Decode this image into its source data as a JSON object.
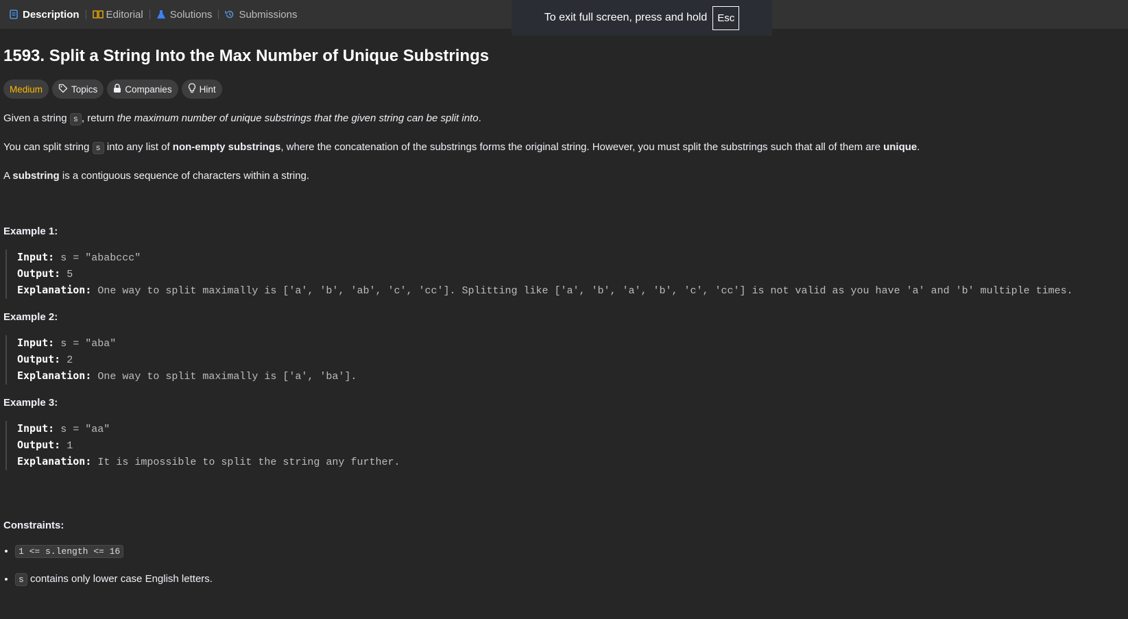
{
  "tabs": {
    "description": "Description",
    "editorial": "Editorial",
    "solutions": "Solutions",
    "submissions": "Submissions"
  },
  "fullscreen": {
    "message": "To exit full screen, press and hold",
    "key": "Esc"
  },
  "problem": {
    "title": "1593. Split a String Into the Max Number of Unique Substrings",
    "tags": {
      "difficulty": "Medium",
      "topics": "Topics",
      "companies": "Companies",
      "hint": "Hint"
    },
    "p1": {
      "a": "Given a string ",
      "code": "s",
      "b": ", return ",
      "em": "the maximum number of unique substrings that the given string can be split into",
      "c": "."
    },
    "p2": {
      "a": "You can split string ",
      "code": "s",
      "b": " into any list of ",
      "strong1": "non-empty substrings",
      "c": ", where the concatenation of the substrings forms the original string. However, you must split the substrings such that all of them are ",
      "strong2": "unique",
      "d": "."
    },
    "p3": {
      "a": "A ",
      "strong": "substring",
      "b": " is a contiguous sequence of characters within a string."
    }
  },
  "examples": [
    {
      "title": "Example 1:",
      "input_label": "Input:",
      "input": " s = \"ababccc\"",
      "output_label": "Output:",
      "output": " 5",
      "expl_label": "Explanation:",
      "expl": " One way to split maximally is ['a', 'b', 'ab', 'c', 'cc']. Splitting like ['a', 'b', 'a', 'b', 'c', 'cc'] is not valid as you have 'a' and 'b' multiple times."
    },
    {
      "title": "Example 2:",
      "input_label": "Input:",
      "input": " s = \"aba\"",
      "output_label": "Output:",
      "output": " 2",
      "expl_label": "Explanation:",
      "expl": " One way to split maximally is ['a', 'ba']."
    },
    {
      "title": "Example 3:",
      "input_label": "Input:",
      "input": " s = \"aa\"",
      "output_label": "Output:",
      "output": " 1",
      "expl_label": "Explanation:",
      "expl": " It is impossible to split the string any further."
    }
  ],
  "constraints": {
    "title": "Constraints:",
    "c1": "1 <= s.length <= 16",
    "c2_code": "s",
    "c2_text": " contains only lower case English letters."
  },
  "colors": {
    "background": "#262626",
    "tabbar": "#333333",
    "medium": "#ffb800",
    "description_icon": "#4a90e2",
    "solutions_icon": "#3b82f6",
    "submissions_icon": "#5a8fd6"
  }
}
